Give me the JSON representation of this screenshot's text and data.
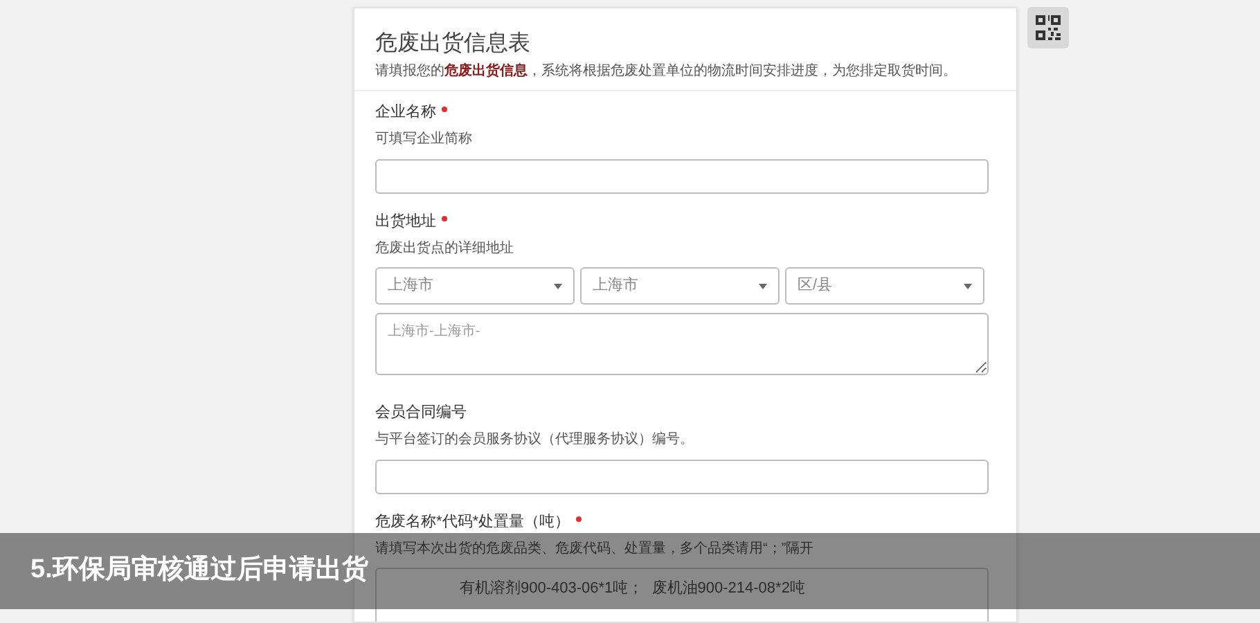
{
  "form": {
    "title": "危废出货信息表",
    "intro": "请填报您的**危废出货信息**，系统将根据危废处置单位的物流时间安排进度，为您排定取货时间。",
    "fields": [
      {
        "kind": "text",
        "label": "企业名称",
        "required": true,
        "hint": "可填写企业简称"
      },
      {
        "kind": "address",
        "label": "出货地址",
        "required": true,
        "hint": "危废出货点的详细地址",
        "selects": [
          {
            "value": "上海市"
          },
          {
            "value": "上海市"
          },
          {
            "value": "区/县"
          }
        ],
        "detail_placeholder": "上海市-上海市-"
      },
      {
        "kind": "text",
        "label": "会员合同编号",
        "required": false,
        "hint": "与平台签订的会员服务协议（代理服务协议）编号。"
      },
      {
        "kind": "textarea",
        "label": "危废名称*代码*处置量（吨）",
        "required": true,
        "hint": "请填写本次出货的危废品类、危废代码、处置量，多个品类请用“；”隔开",
        "placeholder": "有机溶剂900-403-06*1吨；  废机油900-214-08*2吨"
      }
    ]
  },
  "caption": "5.环保局审核通过后申请出货"
}
